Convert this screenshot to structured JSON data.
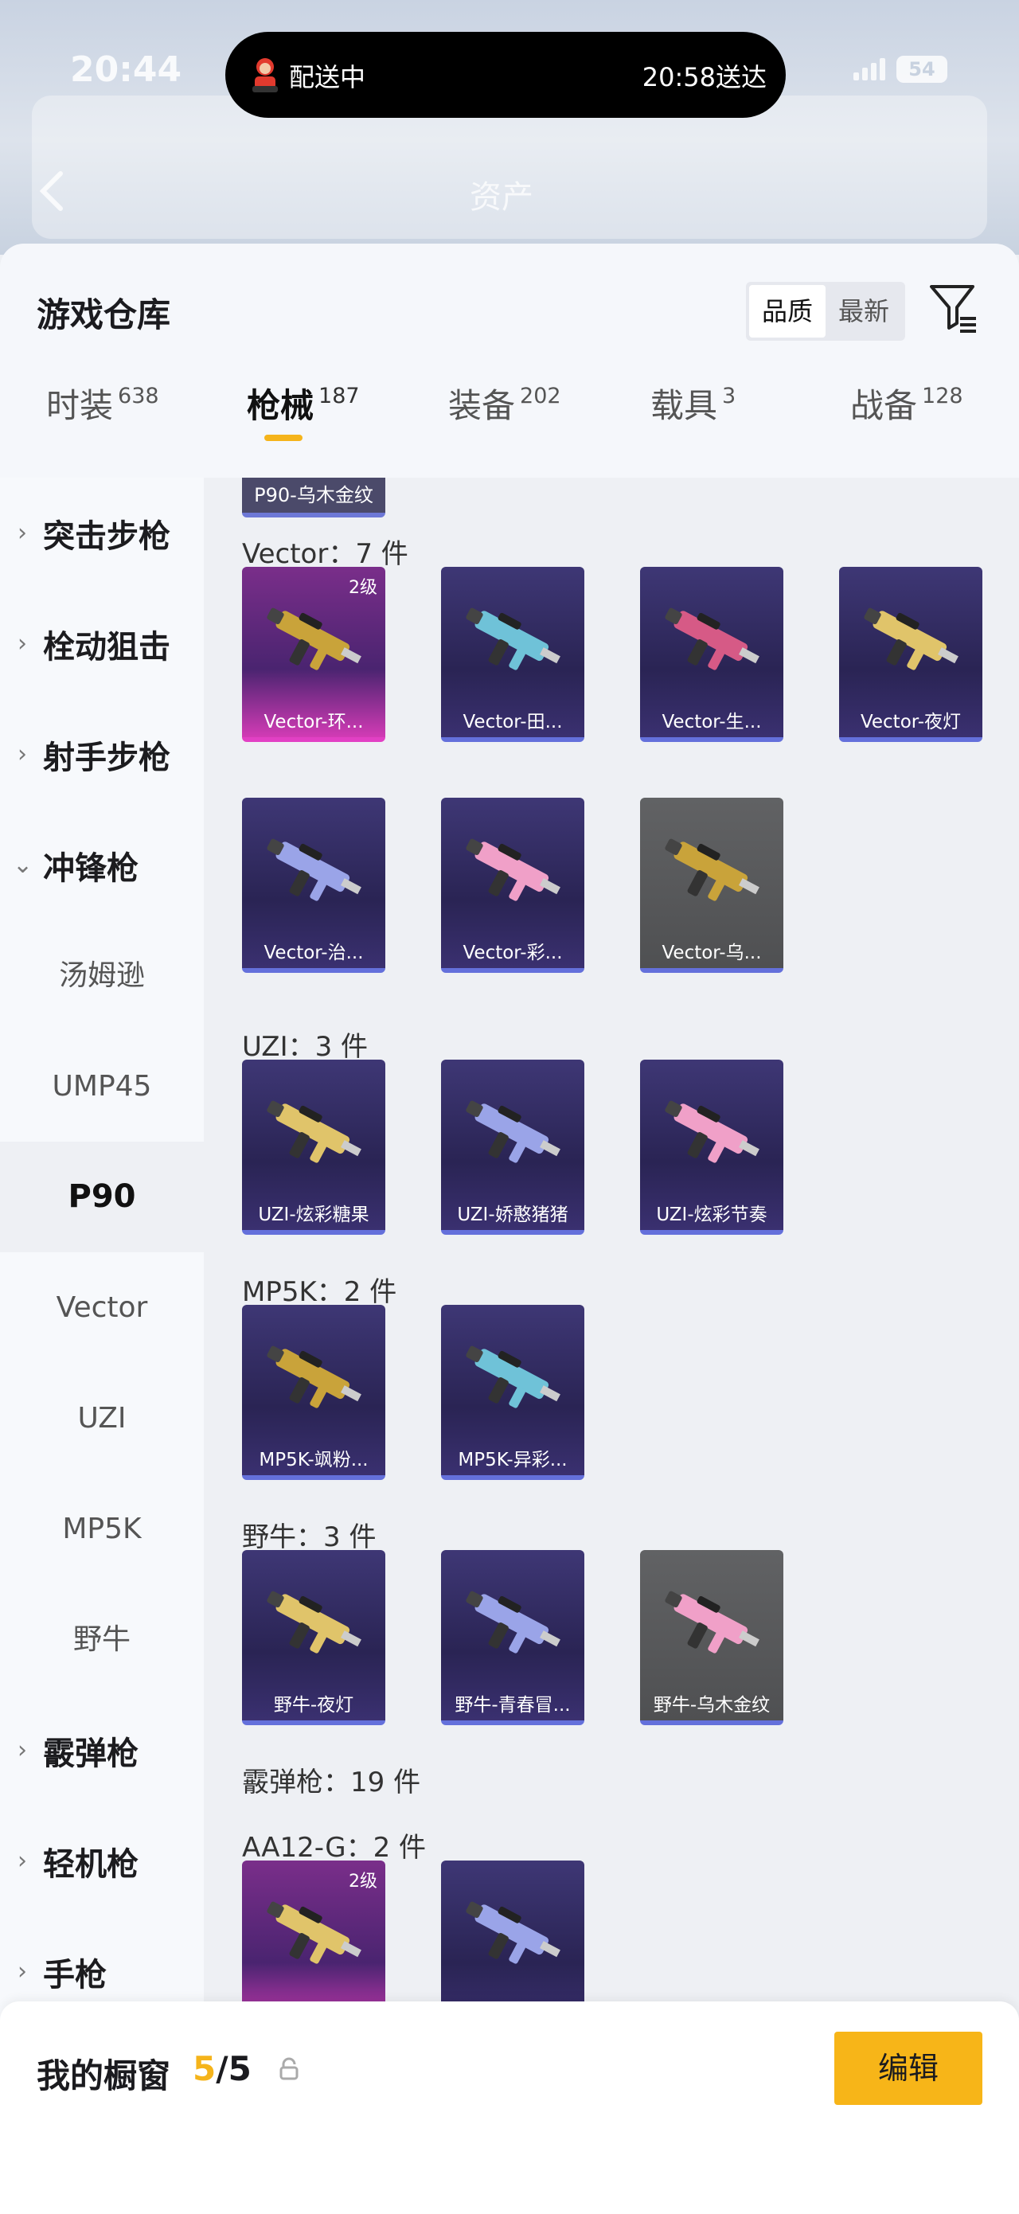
{
  "status_bar": {
    "time": "20:44",
    "battery": "54"
  },
  "island": {
    "label": "配送中",
    "eta": "20:58送达"
  },
  "background": {
    "title": "资产"
  },
  "panel": {
    "title": "游戏仓库",
    "sort_options": [
      "品质",
      "最新"
    ],
    "sort_selected": "品质"
  },
  "tabs": [
    {
      "label": "时装",
      "count": "638",
      "active": false
    },
    {
      "label": "枪械",
      "count": "187",
      "active": true
    },
    {
      "label": "装备",
      "count": "202",
      "active": false
    },
    {
      "label": "载具",
      "count": "3",
      "active": false
    },
    {
      "label": "战备",
      "count": "128",
      "active": false
    }
  ],
  "sidebar": {
    "categories": [
      {
        "label": "突击步枪",
        "expanded": false
      },
      {
        "label": "栓动狙击",
        "expanded": false
      },
      {
        "label": "射手步枪",
        "expanded": false
      },
      {
        "label": "冲锋枪",
        "expanded": true
      }
    ],
    "sub_items": [
      "汤姆逊",
      "UMP45",
      "P90",
      "Vector",
      "UZI",
      "MP5K",
      "野牛"
    ],
    "selected_sub": "P90",
    "more_categories": [
      "霰弹枪",
      "轻机枪",
      "手枪"
    ]
  },
  "content": {
    "top_chip": "P90-乌木金纹",
    "sections": [
      {
        "title": "Vector：7 件",
        "items": [
          {
            "name": "Vector-环...",
            "rarity": "pink",
            "level": "2级"
          },
          {
            "name": "Vector-田...",
            "rarity": "purple",
            "level": ""
          },
          {
            "name": "Vector-生...",
            "rarity": "purple",
            "level": ""
          },
          {
            "name": "Vector-夜灯",
            "rarity": "purple",
            "level": ""
          },
          {
            "name": "Vector-治...",
            "rarity": "purple",
            "level": ""
          },
          {
            "name": "Vector-彩...",
            "rarity": "purple",
            "level": ""
          },
          {
            "name": "Vector-乌...",
            "rarity": "grey",
            "level": ""
          }
        ]
      },
      {
        "title": "UZI：3 件",
        "items": [
          {
            "name": "UZI-炫彩糖果",
            "rarity": "purple",
            "level": ""
          },
          {
            "name": "UZI-娇憨猪猪",
            "rarity": "purple",
            "level": ""
          },
          {
            "name": "UZI-炫彩节奏",
            "rarity": "purple",
            "level": ""
          }
        ]
      },
      {
        "title": "MP5K：2 件",
        "items": [
          {
            "name": "MP5K-飒粉...",
            "rarity": "purple",
            "level": ""
          },
          {
            "name": "MP5K-异彩...",
            "rarity": "purple",
            "level": ""
          }
        ]
      },
      {
        "title": "野牛：3 件",
        "items": [
          {
            "name": "野牛-夜灯",
            "rarity": "purple",
            "level": ""
          },
          {
            "name": "野牛-青春冒...",
            "rarity": "purple",
            "level": ""
          },
          {
            "name": "野牛-乌木金纹",
            "rarity": "grey",
            "level": ""
          }
        ]
      },
      {
        "title": "霰弹枪：19 件",
        "items": []
      },
      {
        "title": "AA12-G：2 件",
        "items": [
          {
            "name": "",
            "rarity": "pink",
            "level": "2级"
          },
          {
            "name": "",
            "rarity": "purple",
            "level": ""
          }
        ]
      }
    ]
  },
  "showcase": {
    "label": "我的橱窗",
    "current": "5",
    "total": "/5",
    "edit_label": "编辑"
  },
  "colors": {
    "accent": "#f7b518",
    "pink": "#e240c4",
    "purple": "#6470db"
  }
}
